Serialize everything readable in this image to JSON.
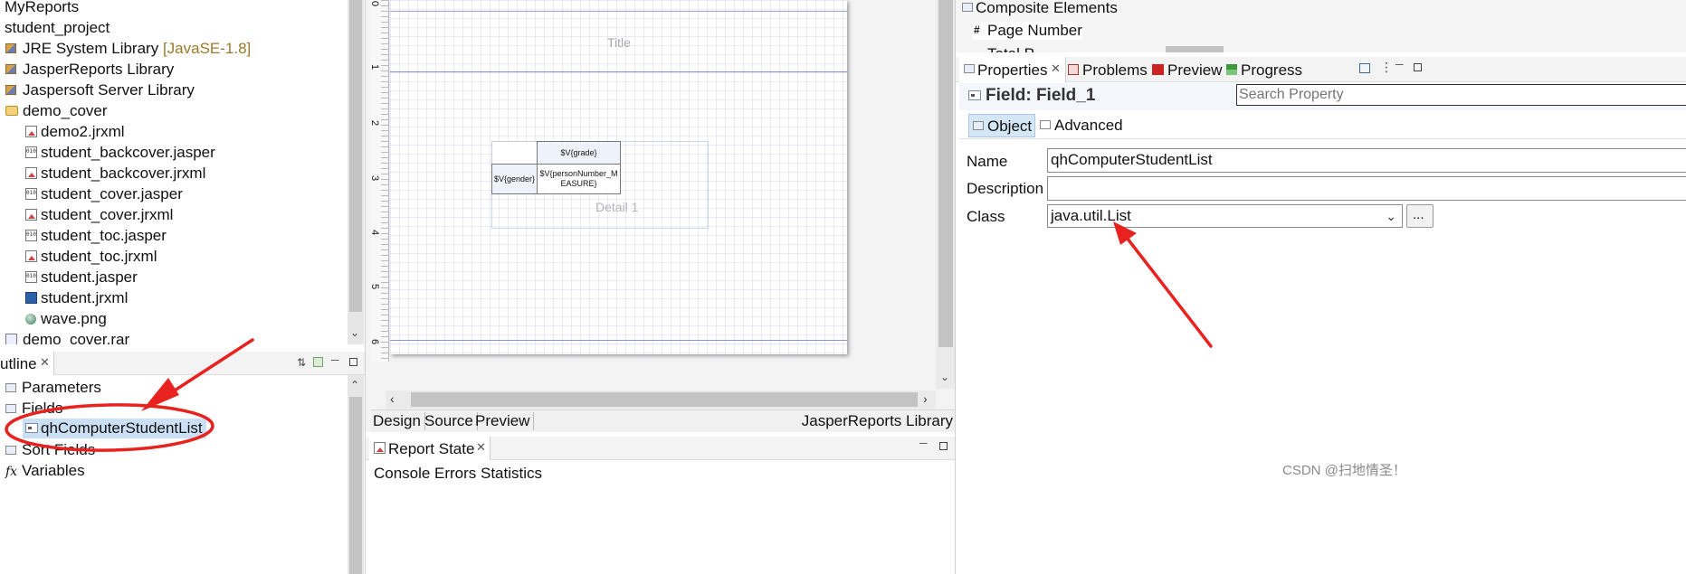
{
  "project_explorer": {
    "items": [
      {
        "label": "MyReports",
        "extra": "",
        "icon": "none-icon"
      },
      {
        "label": "student_project",
        "extra": "",
        "icon": "none-icon"
      },
      {
        "label": "JRE System Library",
        "extra": "[JavaSE-1.8]",
        "icon": "library-icon"
      },
      {
        "label": "JasperReports Library",
        "extra": "",
        "icon": "library-icon"
      },
      {
        "label": "Jaspersoft Server Library",
        "extra": "",
        "icon": "library-icon"
      },
      {
        "label": "demo_cover",
        "extra": "",
        "icon": "folder-icon"
      },
      {
        "label": "demo2.jrxml",
        "extra": "",
        "icon": "jrxml-icon"
      },
      {
        "label": "student_backcover.jasper",
        "extra": "",
        "icon": "jasper-icon"
      },
      {
        "label": "student_backcover.jrxml",
        "extra": "",
        "icon": "jrxml-icon"
      },
      {
        "label": "student_cover.jasper",
        "extra": "",
        "icon": "jasper-icon"
      },
      {
        "label": "student_cover.jrxml",
        "extra": "",
        "icon": "jrxml-icon"
      },
      {
        "label": "student_toc.jasper",
        "extra": "",
        "icon": "jasper-icon"
      },
      {
        "label": "student_toc.jrxml",
        "extra": "",
        "icon": "jrxml-icon"
      },
      {
        "label": "student.jasper",
        "extra": "",
        "icon": "jasper-icon"
      },
      {
        "label": "student.jrxml",
        "extra": "",
        "icon": "jrxml-icon"
      },
      {
        "label": "wave.png",
        "extra": "",
        "icon": "image-icon"
      },
      {
        "label": "demo_cover.rar",
        "extra": "",
        "icon": "archive-icon"
      }
    ]
  },
  "outline": {
    "tab_label": "utline",
    "items": [
      {
        "label": "Parameters"
      },
      {
        "label": "Fields"
      },
      {
        "label": "qhComputerStudentList"
      },
      {
        "label": "Sort Fields"
      },
      {
        "label": "Variables"
      }
    ]
  },
  "designer": {
    "ruler_labels": [
      "0",
      "1",
      "2",
      "3",
      "4",
      "5",
      "6"
    ],
    "band_title": "Title",
    "band_detail": "Detail 1",
    "crosstab": {
      "col_header": "$V{grade}",
      "row_header": "$V{gender}",
      "measure": "$V{personNumber_MEASURE}"
    },
    "tabs": [
      "Design",
      "Source",
      "Preview"
    ],
    "library_label": "JasperReports Library"
  },
  "report_state": {
    "tab_label": "Report State",
    "subtabs": [
      "Console",
      "Errors",
      "Statistics"
    ]
  },
  "palette": {
    "section": "Composite Elements",
    "items": [
      "Page Number",
      "Total P"
    ]
  },
  "properties": {
    "tabs": [
      "Properties",
      "Problems",
      "Preview",
      "Progress"
    ],
    "header": "Field: Field_1",
    "search_placeholder": "Search Property",
    "subtabs": [
      "Object",
      "Advanced"
    ],
    "name_label": "Name",
    "name_value": "qhComputerStudentList",
    "description_label": "Description",
    "description_value": "",
    "class_label": "Class",
    "class_value": "java.util.List",
    "browse_label": "..."
  },
  "watermark": "CSDN @扫地情圣！",
  "colors": {
    "annotation_red": "#e8231f",
    "selection_blue": "#cce0f5",
    "accent_blue": "#1a57a8"
  }
}
